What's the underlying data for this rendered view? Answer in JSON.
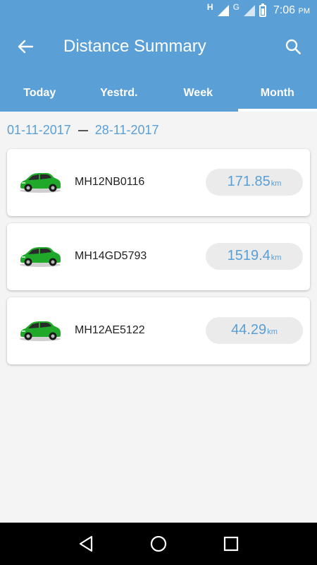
{
  "status_bar": {
    "network_h": "H",
    "network_g": "G",
    "time": "7:06",
    "ampm": "PM"
  },
  "app_bar": {
    "title": "Distance Summary",
    "back_icon": "back-arrow-icon",
    "search_icon": "search-icon"
  },
  "tabs": [
    {
      "label": "Today",
      "active": false
    },
    {
      "label": "Yestrd.",
      "active": false
    },
    {
      "label": "Week",
      "active": false
    },
    {
      "label": "Month",
      "active": true
    }
  ],
  "date_range": {
    "from": "01-11-2017",
    "to": "28-11-2017"
  },
  "vehicles": [
    {
      "plate": "MH12NB0116",
      "distance": "171.85",
      "unit": "km"
    },
    {
      "plate": "MH14GD5793",
      "distance": "1519.4",
      "unit": "km"
    },
    {
      "plate": "MH12AE5122",
      "distance": "44.29",
      "unit": "km"
    }
  ],
  "colors": {
    "accent": "#5a9fd6",
    "car_green": "#1fa82a",
    "pill_bg": "#ebebeb"
  }
}
